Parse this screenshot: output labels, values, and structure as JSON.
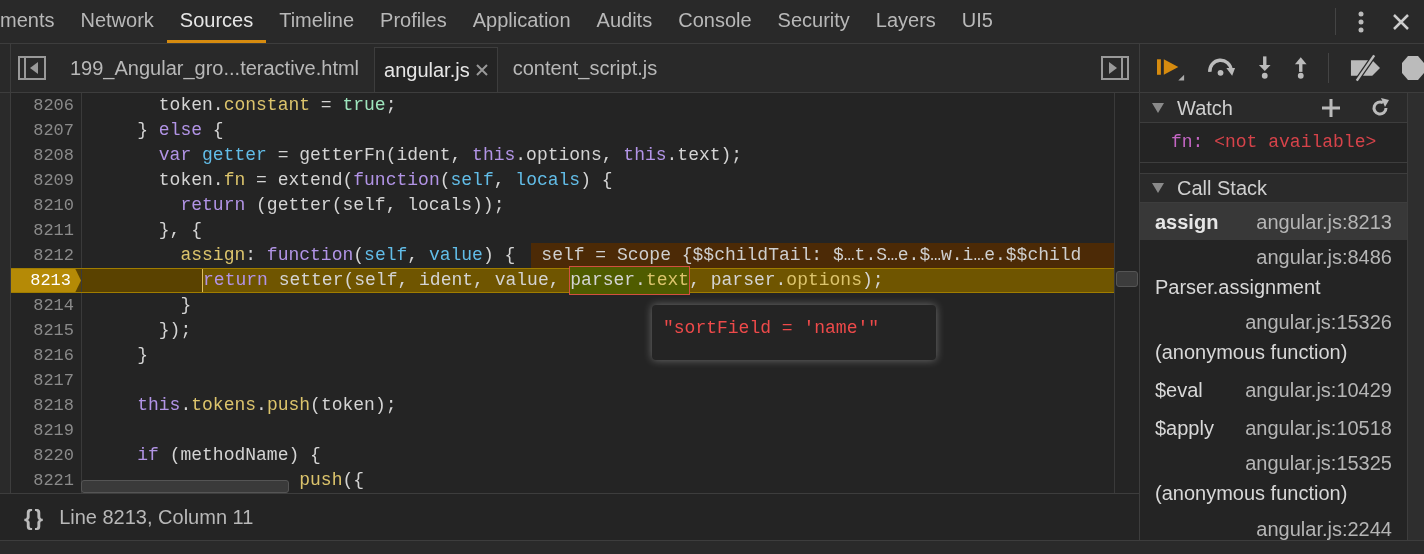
{
  "panel_tabs": [
    {
      "label": "ments",
      "selected": false
    },
    {
      "label": "Network",
      "selected": false
    },
    {
      "label": "Sources",
      "selected": true
    },
    {
      "label": "Timeline",
      "selected": false
    },
    {
      "label": "Profiles",
      "selected": false
    },
    {
      "label": "Application",
      "selected": false
    },
    {
      "label": "Audits",
      "selected": false
    },
    {
      "label": "Console",
      "selected": false
    },
    {
      "label": "Security",
      "selected": false
    },
    {
      "label": "Layers",
      "selected": false
    },
    {
      "label": "UI5",
      "selected": false
    }
  ],
  "file_tabs": [
    {
      "label": "199_Angular_gro...teractive.html",
      "selected": false,
      "closable": false
    },
    {
      "label": "angular.js",
      "selected": true,
      "closable": true
    },
    {
      "label": "content_script.js",
      "selected": false,
      "closable": false
    }
  ],
  "code_lines": [
    {
      "number": "8206",
      "current": false,
      "tokens": [
        {
          "kind": "plain",
          "text": "      token."
        },
        {
          "kind": "prop",
          "text": "constant"
        },
        {
          "kind": "plain",
          "text": " = "
        },
        {
          "kind": "literal",
          "text": "true"
        },
        {
          "kind": "plain",
          "text": ";"
        }
      ]
    },
    {
      "number": "8207",
      "current": false,
      "tokens": [
        {
          "kind": "plain",
          "text": "    } "
        },
        {
          "kind": "keyword",
          "text": "else"
        },
        {
          "kind": "plain",
          "text": " {"
        }
      ]
    },
    {
      "number": "8208",
      "current": false,
      "tokens": [
        {
          "kind": "keyword",
          "text": "      var"
        },
        {
          "kind": "var",
          "text": " getter"
        },
        {
          "kind": "plain",
          "text": " = getterFn(ident, "
        },
        {
          "kind": "keyword",
          "text": "this"
        },
        {
          "kind": "plain",
          "text": ".options, "
        },
        {
          "kind": "keyword",
          "text": "this"
        },
        {
          "kind": "plain",
          "text": ".text);"
        }
      ]
    },
    {
      "number": "8209",
      "current": false,
      "tokens": [
        {
          "kind": "plain",
          "text": "      token."
        },
        {
          "kind": "prop",
          "text": "fn"
        },
        {
          "kind": "plain",
          "text": " = extend("
        },
        {
          "kind": "keyword",
          "text": "function"
        },
        {
          "kind": "plain",
          "text": "("
        },
        {
          "kind": "var",
          "text": "self"
        },
        {
          "kind": "plain",
          "text": ", "
        },
        {
          "kind": "var",
          "text": "locals"
        },
        {
          "kind": "plain",
          "text": ") {"
        }
      ]
    },
    {
      "number": "8210",
      "current": false,
      "tokens": [
        {
          "kind": "keyword",
          "text": "        return"
        },
        {
          "kind": "plain",
          "text": " (getter(self, locals));"
        }
      ]
    },
    {
      "number": "8211",
      "current": false,
      "tokens": [
        {
          "kind": "plain",
          "text": "      }, {"
        }
      ]
    },
    {
      "number": "8212",
      "current": false,
      "tokens": [
        {
          "kind": "prop",
          "text": "        assign"
        },
        {
          "kind": "plain",
          "text": ": "
        },
        {
          "kind": "keyword",
          "text": "function"
        },
        {
          "kind": "plain",
          "text": "("
        },
        {
          "kind": "var",
          "text": "self"
        },
        {
          "kind": "plain",
          "text": ", "
        },
        {
          "kind": "var",
          "text": "value"
        },
        {
          "kind": "plain",
          "text": ") {"
        }
      ],
      "inline_value": "self = Scope {$$childTail: $…t.S…e.$…w.i…e.$$child"
    },
    {
      "number": "8213",
      "current": true,
      "tokens": [
        {
          "kind": "keyword",
          "text": "          return",
          "hovered": false
        },
        {
          "kind": "plain",
          "text": " setter(self, ident, value, ",
          "hovered": false
        },
        {
          "kind": "plain",
          "text": "parser.",
          "hovered": true
        },
        {
          "kind": "prop",
          "text": "text",
          "hovered": true
        },
        {
          "kind": "plain",
          "text": ", parser.",
          "hovered": false
        },
        {
          "kind": "prop",
          "text": "options",
          "hovered": false
        },
        {
          "kind": "plain",
          "text": ");",
          "hovered": false
        }
      ]
    },
    {
      "number": "8214",
      "current": false,
      "tokens": [
        {
          "kind": "plain",
          "text": "        }"
        }
      ]
    },
    {
      "number": "8215",
      "current": false,
      "tokens": [
        {
          "kind": "plain",
          "text": "      });"
        }
      ]
    },
    {
      "number": "8216",
      "current": false,
      "tokens": [
        {
          "kind": "plain",
          "text": "    }"
        }
      ]
    },
    {
      "number": "8217",
      "current": false
    },
    {
      "number": "8218",
      "current": false,
      "tokens": [
        {
          "kind": "keyword",
          "text": "    this"
        },
        {
          "kind": "plain",
          "text": "."
        },
        {
          "kind": "prop",
          "text": "tokens"
        },
        {
          "kind": "plain",
          "text": "."
        },
        {
          "kind": "prop",
          "text": "push"
        },
        {
          "kind": "plain",
          "text": "(token);"
        }
      ]
    },
    {
      "number": "8219",
      "current": false
    },
    {
      "number": "8220",
      "current": false,
      "tokens": [
        {
          "kind": "keyword",
          "text": "    if"
        },
        {
          "kind": "plain",
          "text": " (methodName) {"
        }
      ]
    },
    {
      "number": "8221",
      "current": false,
      "tokens": [
        {
          "kind": "prop",
          "text": "                   push"
        },
        {
          "kind": "plain",
          "text": "({"
        }
      ]
    }
  ],
  "hover_tooltip": "\"sortField = 'name'\"",
  "status_bar": {
    "pretty_print": "{}",
    "position": "Line 8213, Column 11"
  },
  "watch": {
    "title": "Watch",
    "expanded": true,
    "items": [
      {
        "name": "fn:",
        "value": "<not available>"
      }
    ]
  },
  "call_stack": {
    "title": "Call Stack",
    "expanded": true,
    "frames": [
      {
        "function": "assign",
        "location": "angular.js:8213",
        "selected": true,
        "kind": "inline"
      },
      {
        "function": "Parser.assignment",
        "location": "angular.js:8486",
        "selected": false,
        "kind": "wrapped"
      },
      {
        "function": "(anonymous function)",
        "location": "angular.js:15326",
        "selected": false,
        "kind": "wrapped"
      },
      {
        "function": "$eval",
        "location": "angular.js:10429",
        "selected": false,
        "kind": "inline"
      },
      {
        "function": "$apply",
        "location": "angular.js:10518",
        "selected": false,
        "kind": "inline"
      },
      {
        "function": "(anonymous function)",
        "location": "angular.js:15325",
        "selected": false,
        "kind": "wrapped"
      },
      {
        "location": "angular.js:2244",
        "selected": false,
        "kind": "cut"
      }
    ]
  }
}
